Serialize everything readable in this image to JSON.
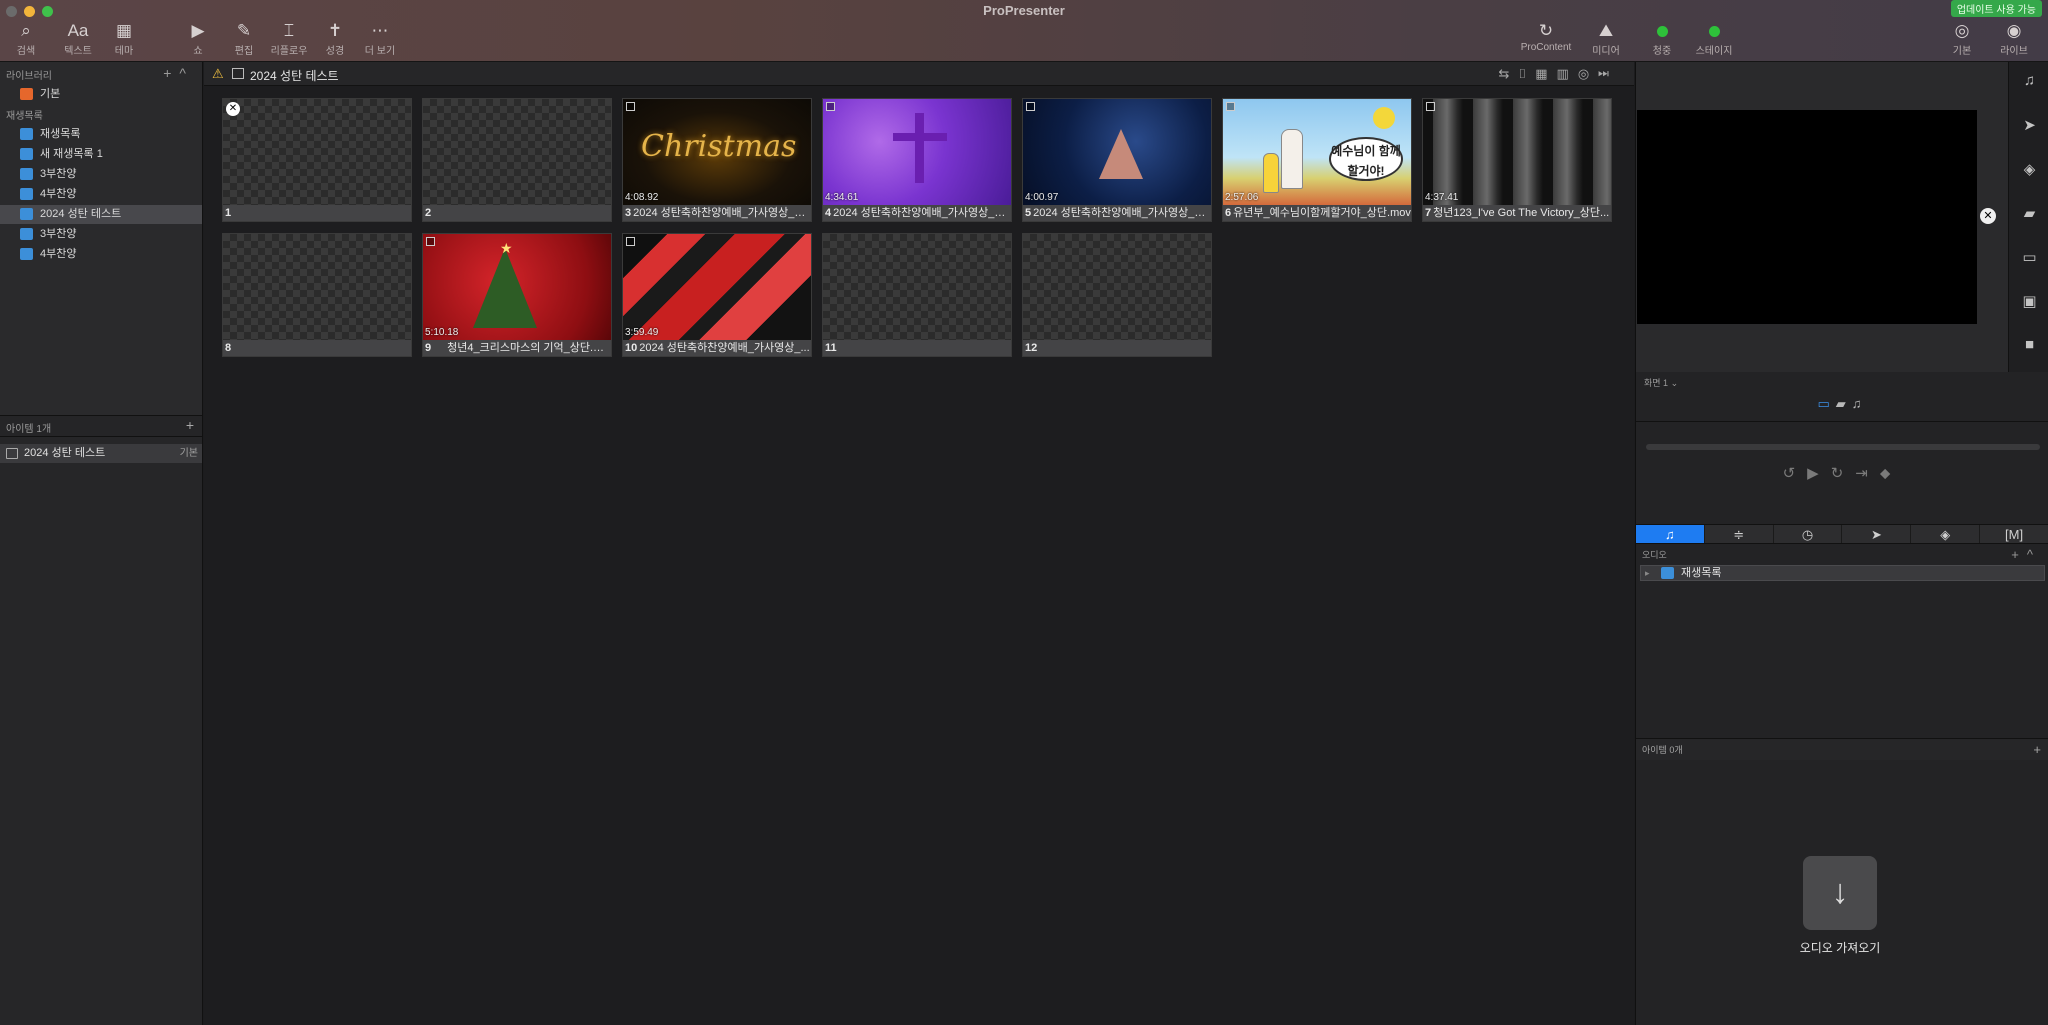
{
  "app": {
    "title": "ProPresenter",
    "update_badge": "업데이트 사용 가능"
  },
  "toolbar": {
    "left": [
      {
        "name": "search",
        "label": "검색",
        "icon": "search-icon"
      },
      {
        "name": "text",
        "label": "텍스트",
        "icon_text": "Aa"
      },
      {
        "name": "theme",
        "label": "테마",
        "icon": "theme-icon"
      },
      {
        "name": "show",
        "label": "쇼",
        "icon": "play-icon"
      },
      {
        "name": "edit",
        "label": "편집",
        "icon": "pencil-icon"
      },
      {
        "name": "reflow",
        "label": "리플로우",
        "icon": "reflow-icon"
      },
      {
        "name": "bible",
        "label": "성경",
        "icon": "bible-icon"
      },
      {
        "name": "more",
        "label": "더 보기",
        "icon": "more-icon"
      }
    ],
    "right": [
      {
        "name": "procontent",
        "label": "ProContent",
        "icon": "refresh-icon"
      },
      {
        "name": "media",
        "label": "미디어",
        "icon": "media-icon"
      },
      {
        "name": "audience",
        "label": "청중",
        "status_color": "#2ec13a"
      },
      {
        "name": "stage",
        "label": "스테이지",
        "status_color": "#2ec13a"
      },
      {
        "name": "default",
        "label": "기본",
        "icon": "mask-icon"
      },
      {
        "name": "live",
        "label": "라이브",
        "icon": "broadcast-icon"
      }
    ]
  },
  "sidebar": {
    "library_header": "라이브러리",
    "library_item": "기본",
    "playlists_header": "재생목록",
    "playlists": [
      {
        "label": "재생목록",
        "selected": false
      },
      {
        "label": "새 재생목록 1",
        "selected": false
      },
      {
        "label": "3부찬양",
        "selected": false
      },
      {
        "label": "4부찬양",
        "selected": false
      },
      {
        "label": "2024 성탄 테스트",
        "selected": true
      },
      {
        "label": "3부찬양",
        "selected": false
      },
      {
        "label": "4부찬양",
        "selected": false
      }
    ],
    "items_header": "아이템 1개",
    "items": [
      {
        "label": "2024 성탄 테스트",
        "tag": "기본"
      }
    ]
  },
  "presentation": {
    "title": "2024 성탄 테스트",
    "slides": [
      {
        "num": "1",
        "caption": "",
        "duration": "",
        "art": "empty",
        "badge": true
      },
      {
        "num": "2",
        "caption": "",
        "duration": "",
        "art": "empty"
      },
      {
        "num": "3",
        "caption": "2024 성탄축하찬양예배_가사영상_중...",
        "duration": "4:08.92",
        "art": "christmas",
        "art_text": "Christmas"
      },
      {
        "num": "4",
        "caption": "2024 성탄축하찬양예배_가사영상_유...",
        "duration": "4:34.61",
        "art": "purple"
      },
      {
        "num": "5",
        "caption": "2024 성탄축하찬양예배_가사영상_초...",
        "duration": "4:00.97",
        "art": "space"
      },
      {
        "num": "6",
        "caption": "유년부_예수님이함께할거야_상단.mov",
        "duration": "2:57.06",
        "art": "drawing",
        "art_text": "예수님이 함께 할거야!"
      },
      {
        "num": "7",
        "caption": "청년123_I've Got The Victory_상단...",
        "duration": "4:37.41",
        "art": "victory"
      },
      {
        "num": "8",
        "caption": "",
        "duration": "",
        "art": "empty"
      },
      {
        "num": "9",
        "caption": "청년4_크리스마스의 기억_상단.mp4",
        "duration": "5:10.18",
        "art": "redtree"
      },
      {
        "num": "10",
        "caption": "2024 성탄축하찬양예배_가사영상_...",
        "duration": "3:59.49",
        "art": "ribbons"
      },
      {
        "num": "11",
        "caption": "",
        "duration": "",
        "art": "empty"
      },
      {
        "num": "12",
        "caption": "",
        "duration": "",
        "art": "empty"
      }
    ]
  },
  "right_panel": {
    "screen_selector": "화면 1 ⌄",
    "audio_header": "오디오",
    "audio_rows": [
      {
        "label": "재생목록"
      }
    ],
    "items_header": "아이템 0개",
    "import_label": "오디오 가져오기",
    "tabs": [
      "music-icon",
      "bars-icon",
      "timer-icon",
      "send-icon",
      "layers-icon",
      "macro-icon"
    ],
    "macro_tab_text": "[M]",
    "active_tab": 0
  }
}
